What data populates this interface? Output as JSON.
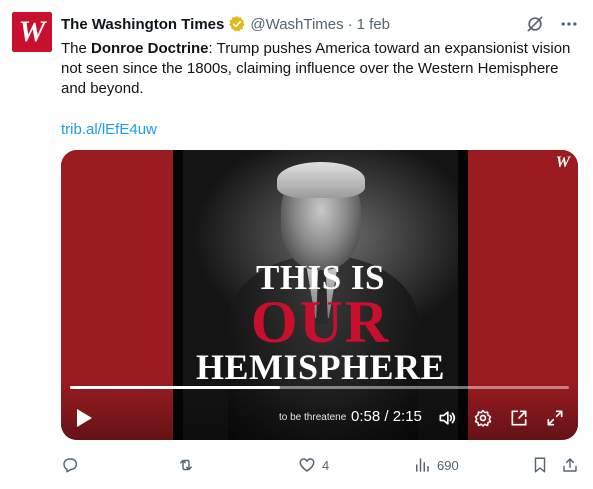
{
  "author": {
    "avatar_letter": "W",
    "name": "The Washington Times",
    "handle": "@WashTimes",
    "separator": "·",
    "date": "1 feb",
    "verified_color": "#e2b719"
  },
  "tweet": {
    "text_prefix": "The ",
    "text_bold": "Donroe Doctrine",
    "text_suffix": ": Trump pushes America toward an expansionist vision not seen since the 1800s, claiming influence over the Western Hemisphere and beyond.",
    "link": "trib.al/lEfE4uw"
  },
  "media": {
    "overlay_line1": "THIS IS",
    "overlay_line2": "OUR",
    "overlay_line3": "HEMISPHERE",
    "logo": "W",
    "caption": "to be threatene",
    "time": "0:58 / 2:15",
    "progress": 0.42
  },
  "actions": {
    "reply_count": "",
    "retweet_count": "",
    "like_count": "4",
    "views_count": "690"
  },
  "colors": {
    "brand_red": "#c8102e",
    "link_blue": "#1d9bf0",
    "muted": "#536471"
  }
}
